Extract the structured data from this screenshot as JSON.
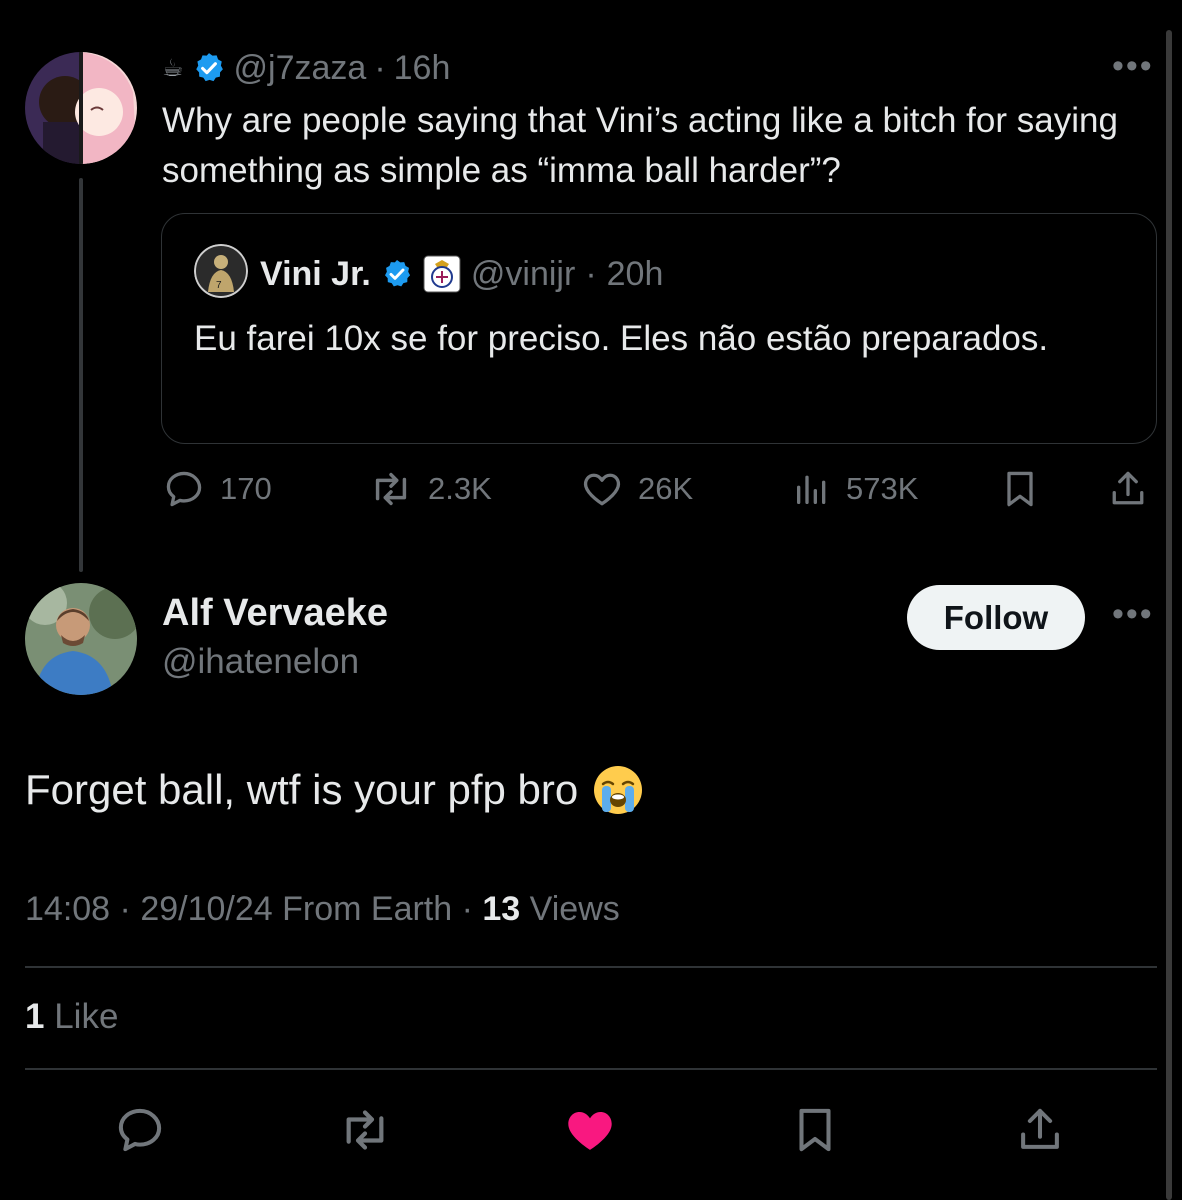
{
  "parent_tweet": {
    "coffee_icon": "coffee-icon",
    "handle": "@j7zaza",
    "separator": "·",
    "time": "16h",
    "text": "Why are people saying that Vini’s acting like a bitch for saying something as simple as “imma ball harder”?",
    "quote": {
      "name": "Vini Jr.",
      "handle": "@vinijr",
      "separator": "·",
      "time": "20h",
      "text": "Eu farei 10x se for preciso. Eles não estão preparados."
    },
    "stats": {
      "replies": "170",
      "reposts": "2.3K",
      "likes": "26K",
      "views": "573K"
    }
  },
  "reply": {
    "name": "Alf Vervaeke",
    "handle": "@ihatenelon",
    "follow_label": "Follow",
    "text": "Forget ball, wtf is your pfp bro",
    "emoji": "loudly-crying-face",
    "meta": {
      "time": "14:08",
      "sep1": "·",
      "date_source": "29/10/24 From Earth",
      "sep2": "·",
      "views_count": "13",
      "views_label": "Views"
    },
    "likes": {
      "count": "1",
      "label": "Like"
    }
  },
  "colors": {
    "background": "#000000",
    "text": "#e7e9ea",
    "muted": "#71767b",
    "verified": "#1d9bf0",
    "liked": "#f91880",
    "divider": "#2f3336"
  }
}
